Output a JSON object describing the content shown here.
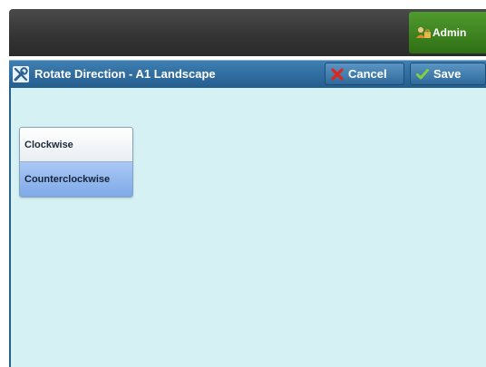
{
  "header": {
    "admin_label": "Admin"
  },
  "titlebar": {
    "title": "Rotate Direction - A1 Landscape",
    "cancel_label": "Cancel",
    "save_label": "Save"
  },
  "options": {
    "items": [
      {
        "label": "Clockwise",
        "selected": false
      },
      {
        "label": "Counterclockwise",
        "selected": true
      }
    ]
  },
  "colors": {
    "title_bar": "#2f6a9c",
    "content_bg": "#d6f1f4",
    "admin_green": "#3f8a22",
    "selected_option": "#8fb4ee"
  },
  "icons": {
    "title": "tools-icon",
    "admin": "admin-user-icon",
    "cancel": "x-icon",
    "save": "checkmark-icon"
  }
}
